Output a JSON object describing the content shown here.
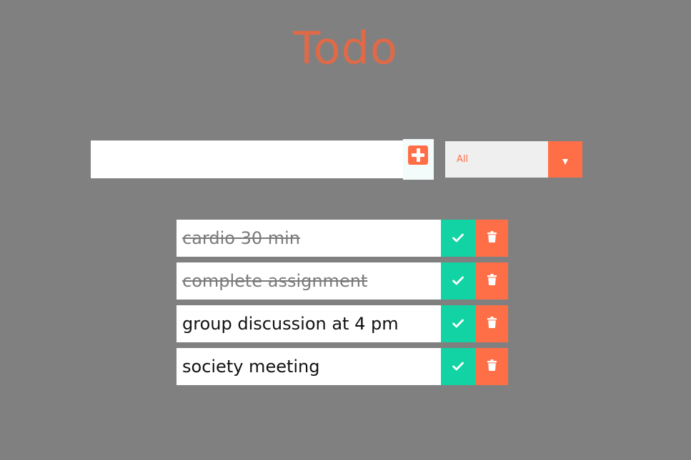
{
  "app": {
    "title": "Todo"
  },
  "form": {
    "input_value": "",
    "input_placeholder": "",
    "add_icon": "plus-square-icon",
    "filter": {
      "selected": "All",
      "arrow_icon": "caret-down-icon"
    }
  },
  "todos": [
    {
      "text": "cardio 30 min",
      "completed": true
    },
    {
      "text": "complete assignment",
      "completed": true
    },
    {
      "text": "group discussion at 4 pm",
      "completed": false
    },
    {
      "text": "society meeting",
      "completed": false
    }
  ],
  "icons": {
    "check": "check-icon",
    "delete": "trash-icon"
  },
  "colors": {
    "background": "#808080",
    "title": "#e06a48",
    "accent": "#ff6f47",
    "check": "#12d3a3",
    "completed_text": "#7a7a7a"
  }
}
